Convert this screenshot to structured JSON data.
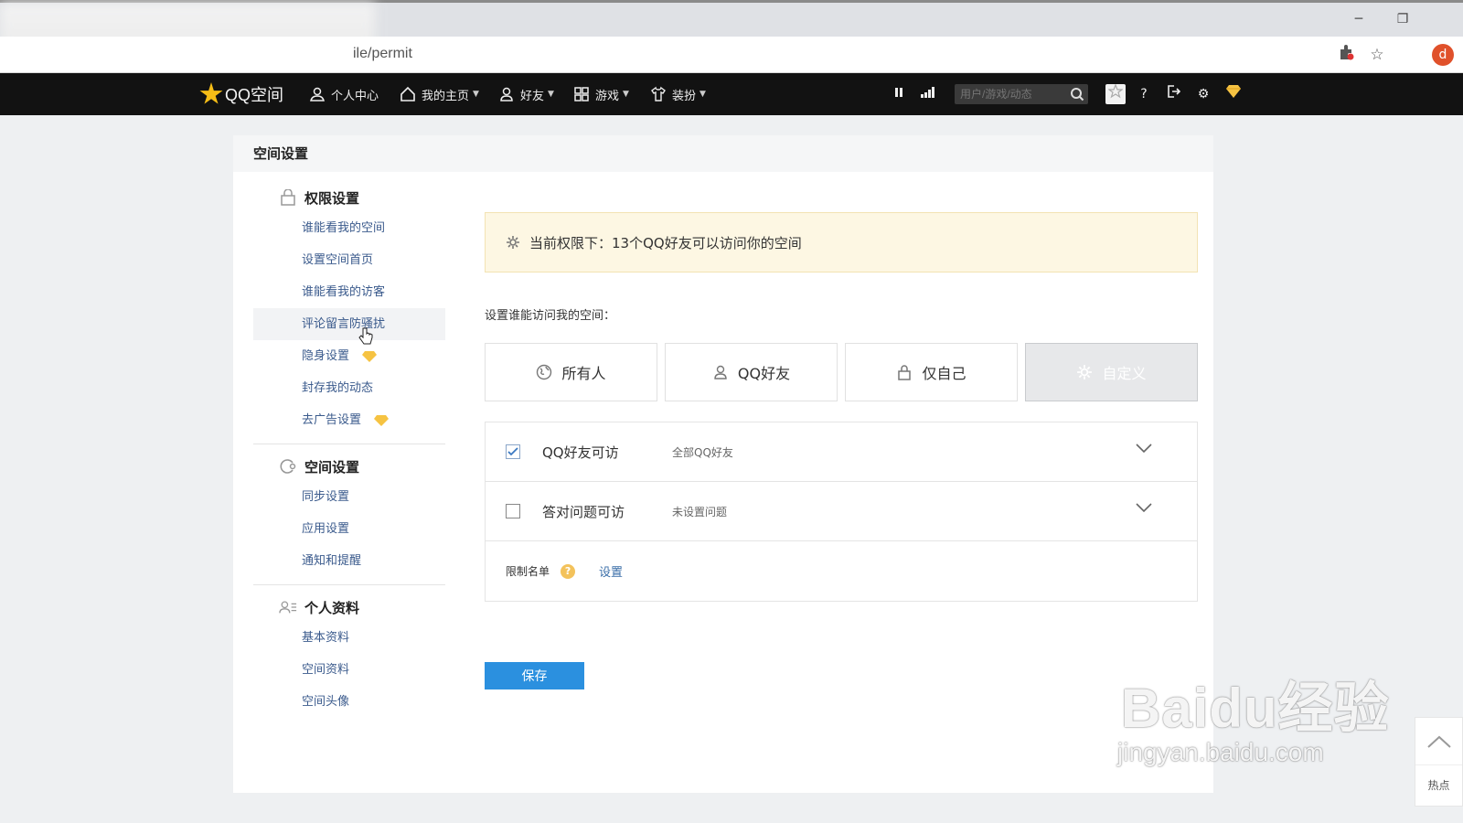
{
  "browser": {
    "url": "ile/permit",
    "profile_initial": "d"
  },
  "nav": {
    "logo": "QQ空间",
    "items": [
      {
        "label": "个人中心",
        "caret": false
      },
      {
        "label": "我的主页",
        "caret": true
      },
      {
        "label": "好友",
        "caret": true
      },
      {
        "label": "游戏",
        "caret": true
      },
      {
        "label": "装扮",
        "caret": true
      }
    ],
    "search_placeholder": "用户/游戏/动态",
    "help": "?"
  },
  "panel": {
    "title": "空间设置"
  },
  "sidebar": {
    "groups": [
      {
        "title": "权限设置",
        "items": [
          "谁能看我的空间",
          "设置空间首页",
          "谁能看我的访客",
          "评论留言防骚扰",
          "隐身设置",
          "封存我的动态",
          "去广告设置"
        ]
      },
      {
        "title": "空间设置",
        "items": [
          "同步设置",
          "应用设置",
          "通知和提醒"
        ]
      },
      {
        "title": "个人资料",
        "items": [
          "基本资料",
          "空间资料",
          "空间头像"
        ]
      }
    ]
  },
  "content": {
    "notice": "当前权限下：13个QQ好友可以访问你的空间",
    "who_label": "设置谁能访问我的空间：",
    "options": [
      "所有人",
      "QQ好友",
      "仅自己",
      "自定义"
    ],
    "rows": [
      {
        "title": "QQ好友可访",
        "sub": "全部QQ好友",
        "checked": true
      },
      {
        "title": "答对问题可访",
        "sub": "未设置问题",
        "checked": false
      }
    ],
    "limit_label": "限制名单",
    "limit_help": "?",
    "limit_link": "设置",
    "save": "保存"
  },
  "watermark": {
    "main": "Baidu经验",
    "sub": "jingyan.baidu.com"
  },
  "hot": {
    "label": "热点"
  },
  "colors": {
    "nav_bg": "#121212",
    "accent_blue": "#2b90df",
    "notice_bg": "#fdf7e3",
    "link": "#3a5a8c",
    "gem": "#f6c342"
  }
}
